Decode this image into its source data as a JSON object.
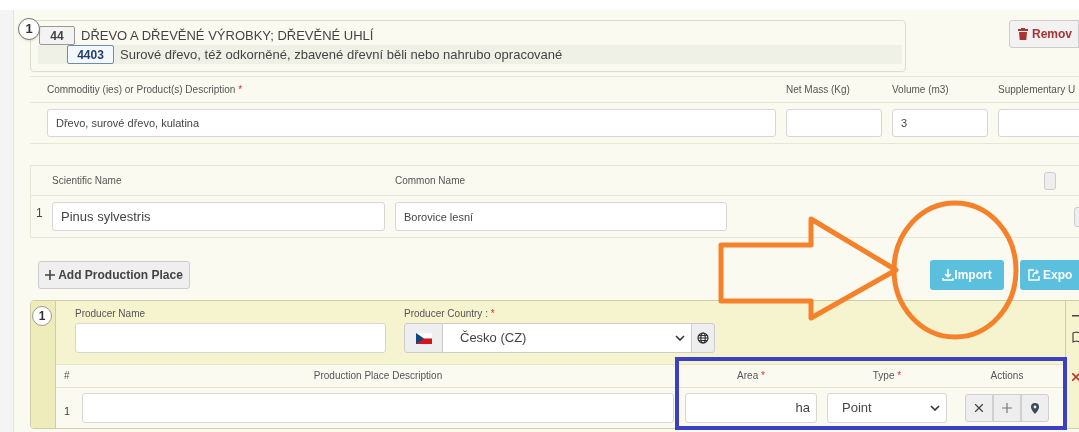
{
  "item_number": "1",
  "hs_chapter": {
    "code": "44",
    "title": "DŘEVO A DŘEVĚNÉ VÝROBKY; DŘEVĚNÉ UHLÍ"
  },
  "hs_heading": {
    "code": "4403",
    "title": "Surové dřevo, též odkorněné, zbavené dřevní běli nebo nahrubo opracované"
  },
  "remove_button": "Remov",
  "commodity_fields": [
    {
      "label": "Commoditiy (ies) or Product(s) Description",
      "required_mark": "*",
      "value": "Dřevo, surové dřevo, kulatina"
    },
    {
      "label": "Net Mass (Kg)"
    },
    {
      "label": "Volume (m3)",
      "value": "3"
    },
    {
      "label": "Supplementary U"
    }
  ],
  "species": {
    "columns": [
      "Scientific Name",
      "Common Name"
    ],
    "rows": [
      {
        "number": "1",
        "scientific_name": "Pinus sylvestris",
        "common_name": "Borovice lesní"
      }
    ]
  },
  "add_production_place_button": "Add Production Place",
  "import_button": "Import",
  "export_button": "Expo",
  "production_place": {
    "number": "1",
    "producer_name": {
      "label": "Producer Name"
    },
    "producer_country": {
      "label": "Producer Country :",
      "required_mark": "*",
      "value": "Česko (CZ)"
    },
    "columns": [
      {
        "label": "#"
      },
      {
        "label": "Production Place Description"
      },
      {
        "label": "Area",
        "required_mark": "*"
      },
      {
        "label": "Type",
        "required_mark": "*"
      },
      {
        "label": "Actions"
      }
    ],
    "rows": [
      {
        "number": "1",
        "area_unit": "ha",
        "type": "Point"
      }
    ]
  },
  "annotations": [
    {
      "kind": "arrow",
      "color": "#f5812b"
    },
    {
      "kind": "circle",
      "color": "#f5812b"
    },
    {
      "kind": "rectangle",
      "color": "#3b3fc4"
    }
  ]
}
